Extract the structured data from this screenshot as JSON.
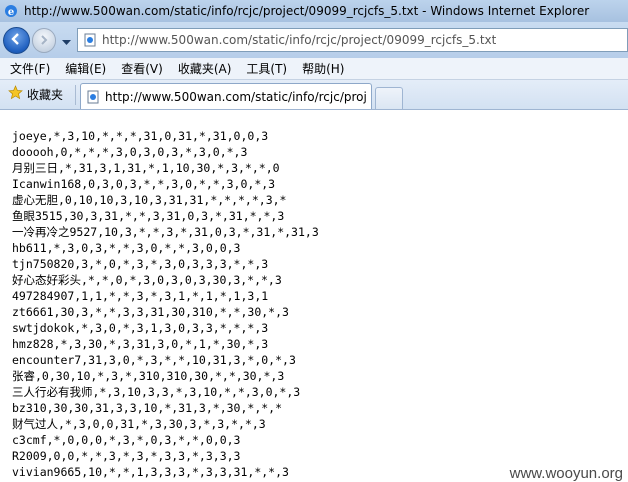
{
  "window": {
    "title": "http://www.500wan.com/static/info/rcjc/project/09099_rcjcfs_5.txt - Windows Internet Explorer"
  },
  "address_bar": {
    "url": "http://www.500wan.com/static/info/rcjc/project/09099_rcjcfs_5.txt"
  },
  "menu": {
    "items": [
      "文件(F)",
      "编辑(E)",
      "查看(V)",
      "收藏夹(A)",
      "工具(T)",
      "帮助(H)"
    ]
  },
  "favorites": {
    "label": "收藏夹"
  },
  "tab": {
    "title": "http://www.500wan.com/static/info/rcjc/proj..."
  },
  "content": {
    "lines": [
      "joeye,*,3,10,*,*,*,31,0,31,*,31,0,0,3",
      "dooooh,0,*,*,*,3,0,3,0,3,*,3,0,*,3",
      "月别三日,*,31,3,1,31,*,1,10,30,*,3,*,*,0",
      "Icanwin168,0,3,0,3,*,*,3,0,*,*,3,0,*,3",
      "虚心无胆,0,10,10,3,10,3,31,31,*,*,*,*,3,*",
      "鱼眼3515,30,3,31,*,*,3,31,0,3,*,31,*,*,3",
      "一冷再冷之9527,10,3,*,*,3,*,31,0,3,*,31,*,31,3",
      "hb611,*,3,0,3,*,*,3,0,*,*,3,0,0,3",
      "tjn750820,3,*,0,*,3,*,3,0,3,3,3,*,*,3",
      "好心态好彩头,*,*,0,*,3,0,3,0,3,30,3,*,*,3",
      "497284907,1,1,*,*,3,*,3,1,*,1,*,1,3,1",
      "zt6661,30,3,*,*,3,3,31,30,310,*,*,30,*,3",
      "swtjdokok,*,3,0,*,3,1,3,0,3,3,*,*,*,3",
      "hmz828,*,3,30,*,3,31,3,0,*,1,*,30,*,3",
      "encounter7,31,3,0,*,3,*,*,10,31,3,*,0,*,3",
      "张睿,0,30,10,*,3,*,310,310,30,*,*,30,*,3",
      "三人行必有我师,*,3,10,3,3,*,3,10,*,*,3,0,*,3",
      "bz310,30,30,31,3,3,10,*,31,3,*,30,*,*,*",
      "财气过人,*,3,0,0,31,*,3,30,3,*,3,*,*,3",
      "c3cmf,*,0,0,0,*,3,*,0,3,*,*,0,0,3",
      "R2009,0,0,*,*,3,*,3,*,3,3,*,3,3,3",
      "vivian9665,10,*,*,1,3,3,3,*,3,3,31,*,*,3"
    ]
  },
  "watermark": "www.wooyun.org"
}
